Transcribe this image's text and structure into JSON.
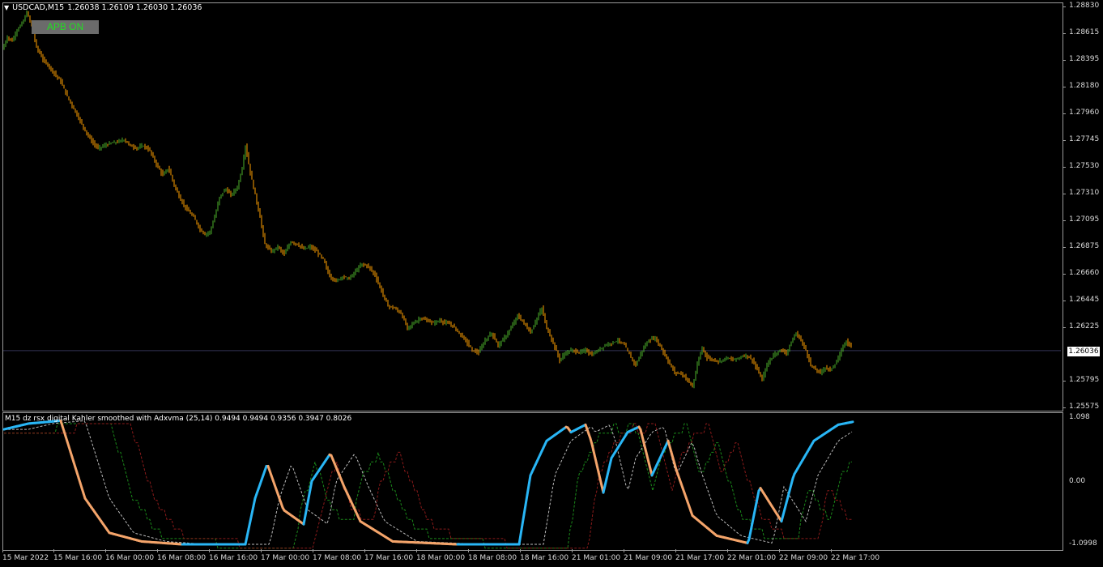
{
  "header": {
    "symbol": "USDCAD,M15",
    "ohlc": "1.26038 1.26109 1.26030 1.26036"
  },
  "badge": {
    "label": "APB ON",
    "text_color": "#22dd22",
    "bg_color": "#6b6b6b"
  },
  "price_axis": {
    "ticks": [
      "1.28830",
      "1.28615",
      "1.28395",
      "1.28180",
      "1.27960",
      "1.27745",
      "1.27530",
      "1.27310",
      "1.27095",
      "1.26875",
      "1.26660",
      "1.26445",
      "1.26225",
      "1.26036",
      "1.25795",
      "1.25575"
    ],
    "current": "1.26036"
  },
  "indicator": {
    "title": "M15 dz rsx digital Kahler smoothed with Adxvma (25,14) 0.9494 0.9494 0.9356 0.3947 0.8026",
    "axis": [
      "1.098",
      "0.00",
      "-1.0998"
    ],
    "colors": {
      "up": "#29b6f6",
      "down": "#f4a46a",
      "level_green": "#1a8a1a",
      "level_red": "#8b1a1a",
      "signal": "#bbbbbb"
    }
  },
  "time_axis": {
    "labels": [
      "15 Mar 2022",
      "15 Mar 16:00",
      "16 Mar 00:00",
      "16 Mar 08:00",
      "16 Mar 16:00",
      "17 Mar 00:00",
      "17 Mar 08:00",
      "17 Mar 16:00",
      "18 Mar 00:00",
      "18 Mar 08:00",
      "18 Mar 16:00",
      "21 Mar 01:00",
      "21 Mar 09:00",
      "21 Mar 17:00",
      "22 Mar 01:00",
      "22 Mar 09:00",
      "22 Mar 17:00"
    ]
  },
  "candle_colors": {
    "bull": "#4caf2a",
    "bear": "#ffa000"
  },
  "chart_data": {
    "type": "line",
    "price_path": [
      [
        0,
        1.2848
      ],
      [
        6,
        1.2858
      ],
      [
        12,
        1.2855
      ],
      [
        18,
        1.2864
      ],
      [
        25,
        1.287
      ],
      [
        30,
        1.2878
      ],
      [
        35,
        1.287
      ],
      [
        42,
        1.285
      ],
      [
        50,
        1.284
      ],
      [
        58,
        1.2834
      ],
      [
        65,
        1.2828
      ],
      [
        72,
        1.2822
      ],
      [
        80,
        1.281
      ],
      [
        88,
        1.28
      ],
      [
        96,
        1.279
      ],
      [
        104,
        1.278
      ],
      [
        112,
        1.2772
      ],
      [
        118,
        1.2768
      ],
      [
        126,
        1.277
      ],
      [
        134,
        1.2772
      ],
      [
        142,
        1.2773
      ],
      [
        150,
        1.2775
      ],
      [
        158,
        1.277
      ],
      [
        166,
        1.2768
      ],
      [
        174,
        1.277
      ],
      [
        182,
        1.2766
      ],
      [
        190,
        1.2755
      ],
      [
        198,
        1.2746
      ],
      [
        205,
        1.2752
      ],
      [
        212,
        1.2738
      ],
      [
        220,
        1.2726
      ],
      [
        228,
        1.2718
      ],
      [
        236,
        1.2712
      ],
      [
        244,
        1.2702
      ],
      [
        250,
        1.2698
      ],
      [
        256,
        1.27
      ],
      [
        262,
        1.2712
      ],
      [
        268,
        1.2728
      ],
      [
        275,
        1.2735
      ],
      [
        282,
        1.273
      ],
      [
        290,
        1.2736
      ],
      [
        296,
        1.2752
      ],
      [
        300,
        1.277
      ],
      [
        306,
        1.2748
      ],
      [
        312,
        1.273
      ],
      [
        318,
        1.2712
      ],
      [
        324,
        1.269
      ],
      [
        332,
        1.2684
      ],
      [
        340,
        1.2688
      ],
      [
        348,
        1.2682
      ],
      [
        356,
        1.2692
      ],
      [
        364,
        1.269
      ],
      [
        372,
        1.2686
      ],
      [
        380,
        1.2688
      ],
      [
        388,
        1.2684
      ],
      [
        396,
        1.2678
      ],
      [
        404,
        1.2664
      ],
      [
        412,
        1.266
      ],
      [
        420,
        1.2664
      ],
      [
        428,
        1.2662
      ],
      [
        436,
        1.2668
      ],
      [
        444,
        1.2674
      ],
      [
        452,
        1.2672
      ],
      [
        460,
        1.2665
      ],
      [
        468,
        1.2652
      ],
      [
        476,
        1.264
      ],
      [
        484,
        1.2638
      ],
      [
        492,
        1.2634
      ],
      [
        500,
        1.2622
      ],
      [
        508,
        1.2626
      ],
      [
        516,
        1.263
      ],
      [
        524,
        1.2628
      ],
      [
        532,
        1.2626
      ],
      [
        540,
        1.2628
      ],
      [
        548,
        1.2626
      ],
      [
        556,
        1.2624
      ],
      [
        564,
        1.2618
      ],
      [
        572,
        1.2612
      ],
      [
        580,
        1.2604
      ],
      [
        588,
        1.2602
      ],
      [
        596,
        1.2612
      ],
      [
        604,
        1.2618
      ],
      [
        612,
        1.2608
      ],
      [
        620,
        1.2614
      ],
      [
        628,
        1.2622
      ],
      [
        636,
        1.2632
      ],
      [
        644,
        1.2626
      ],
      [
        652,
        1.2618
      ],
      [
        660,
        1.263
      ],
      [
        666,
        1.2638
      ],
      [
        672,
        1.2622
      ],
      [
        680,
        1.261
      ],
      [
        688,
        1.2596
      ],
      [
        696,
        1.2602
      ],
      [
        704,
        1.2604
      ],
      [
        712,
        1.2602
      ],
      [
        720,
        1.2604
      ],
      [
        728,
        1.26
      ],
      [
        736,
        1.2604
      ],
      [
        744,
        1.2608
      ],
      [
        752,
        1.261
      ],
      [
        760,
        1.2612
      ],
      [
        768,
        1.2608
      ],
      [
        776,
        1.2598
      ],
      [
        782,
        1.2592
      ],
      [
        790,
        1.2604
      ],
      [
        798,
        1.2612
      ],
      [
        806,
        1.2614
      ],
      [
        814,
        1.2605
      ],
      [
        822,
        1.2595
      ],
      [
        830,
        1.2586
      ],
      [
        838,
        1.2585
      ],
      [
        846,
        1.258
      ],
      [
        852,
        1.2574
      ],
      [
        858,
        1.2592
      ],
      [
        864,
        1.2606
      ],
      [
        870,
        1.2598
      ],
      [
        878,
        1.2596
      ],
      [
        886,
        1.2595
      ],
      [
        894,
        1.2598
      ],
      [
        902,
        1.2596
      ],
      [
        910,
        1.2598
      ],
      [
        918,
        1.26
      ],
      [
        926,
        1.2596
      ],
      [
        932,
        1.2588
      ],
      [
        938,
        1.258
      ],
      [
        944,
        1.2592
      ],
      [
        952,
        1.26
      ],
      [
        960,
        1.2604
      ],
      [
        968,
        1.2602
      ],
      [
        974,
        1.261
      ],
      [
        980,
        1.2618
      ],
      [
        986,
        1.2612
      ],
      [
        992,
        1.2604
      ],
      [
        998,
        1.2592
      ],
      [
        1004,
        1.2588
      ],
      [
        1010,
        1.2586
      ],
      [
        1016,
        1.259
      ],
      [
        1022,
        1.2588
      ],
      [
        1030,
        1.2594
      ],
      [
        1036,
        1.2604
      ],
      [
        1042,
        1.2612
      ],
      [
        1048,
        1.2606
      ]
    ],
    "ind_main": [
      [
        0,
        0.9
      ],
      [
        30,
        1.0
      ],
      [
        70,
        1.05
      ],
      [
        80,
        0.6
      ],
      [
        100,
        -0.3
      ],
      [
        130,
        -0.9
      ],
      [
        170,
        -1.05
      ],
      [
        220,
        -1.1
      ],
      [
        298,
        -1.1
      ],
      [
        310,
        -0.3
      ],
      [
        325,
        0.3
      ],
      [
        345,
        -0.5
      ],
      [
        370,
        -0.75
      ],
      [
        380,
        0.0
      ],
      [
        403,
        0.48
      ],
      [
        420,
        -0.1
      ],
      [
        440,
        -0.7
      ],
      [
        480,
        -1.05
      ],
      [
        560,
        -1.1
      ],
      [
        636,
        -1.1
      ],
      [
        650,
        0.1
      ],
      [
        670,
        0.7
      ],
      [
        695,
        0.95
      ],
      [
        700,
        0.85
      ],
      [
        718,
        0.98
      ],
      [
        725,
        0.7
      ],
      [
        740,
        -0.2
      ],
      [
        750,
        0.4
      ],
      [
        770,
        0.85
      ],
      [
        785,
        0.95
      ],
      [
        800,
        0.1
      ],
      [
        820,
        0.7
      ],
      [
        830,
        0.2
      ],
      [
        850,
        -0.6
      ],
      [
        880,
        -0.95
      ],
      [
        919,
        -1.08
      ],
      [
        933,
        -0.1
      ],
      [
        960,
        -0.7
      ],
      [
        975,
        0.1
      ],
      [
        1000,
        0.7
      ],
      [
        1030,
        0.98
      ],
      [
        1048,
        1.03
      ]
    ]
  }
}
